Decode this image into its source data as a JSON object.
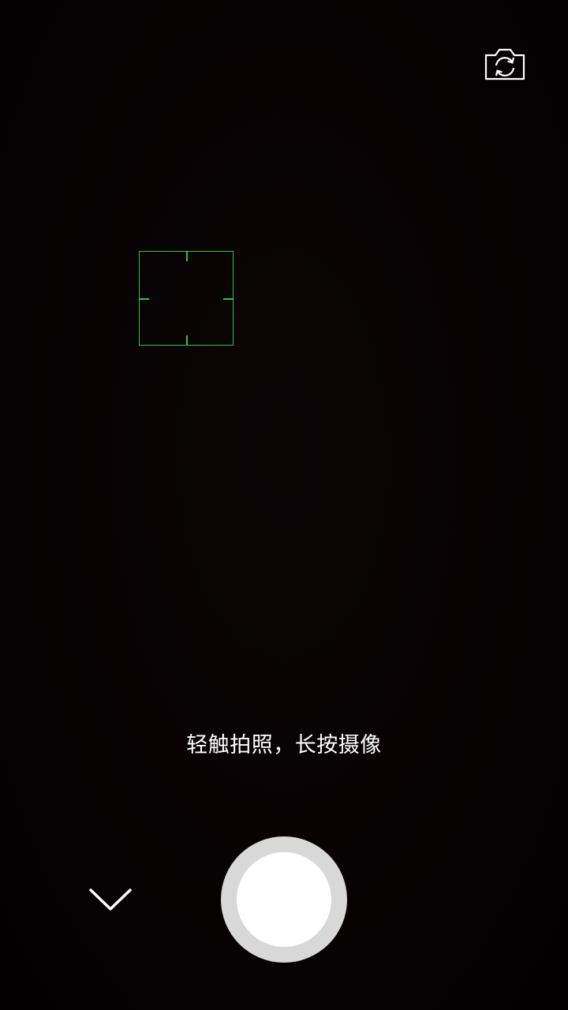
{
  "camera": {
    "hint_text": "轻触拍照，长按摄像",
    "icons": {
      "switch_camera": "switch-camera-icon",
      "collapse": "chevron-down-icon",
      "shutter": "shutter-button"
    },
    "colors": {
      "focus_frame": "#35c638",
      "shutter_ring": "#d8d8d8",
      "shutter_center": "#ffffff",
      "text": "#ffffff"
    }
  }
}
